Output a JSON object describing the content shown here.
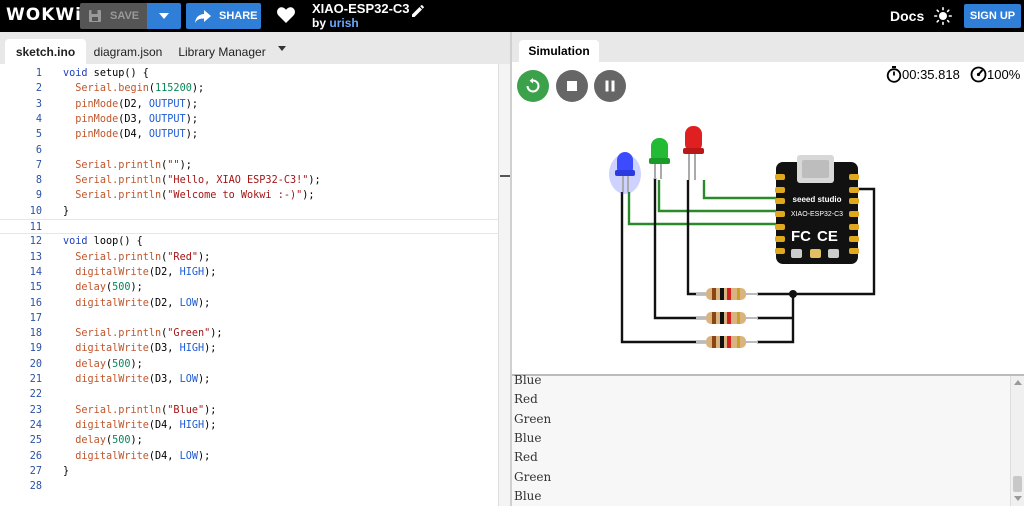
{
  "topbar": {
    "logo": "WOKWi",
    "save_label": "SAVE",
    "share_label": "SHARE",
    "project_title": "XIAO-ESP32-C3",
    "by_label": "by",
    "author": "urish",
    "docs_label": "Docs",
    "signup_label": "SIGN UP"
  },
  "editor": {
    "tabs": [
      "sketch.ino",
      "diagram.json",
      "Library Manager"
    ],
    "active_tab": "sketch.ino",
    "line_numbers": [
      "1",
      "2",
      "3",
      "4",
      "5",
      "6",
      "7",
      "8",
      "9",
      "10",
      "11",
      "12",
      "13",
      "14",
      "15",
      "16",
      "17",
      "18",
      "19",
      "20",
      "21",
      "22",
      "23",
      "24",
      "25",
      "26",
      "27",
      "28"
    ],
    "lines": [
      "void setup() {",
      "  Serial.begin(115200);",
      "  pinMode(D2, OUTPUT);",
      "  pinMode(D3, OUTPUT);",
      "  pinMode(D4, OUTPUT);",
      "",
      "  Serial.println(\"\");",
      "  Serial.println(\"Hello, XIAO ESP32-C3!\");",
      "  Serial.println(\"Welcome to Wokwi :-)\");",
      "}",
      "",
      "void loop() {",
      "  Serial.println(\"Red\");",
      "  digitalWrite(D2, HIGH);",
      "  delay(500);",
      "  digitalWrite(D2, LOW);",
      "",
      "  Serial.println(\"Green\");",
      "  digitalWrite(D3, HIGH);",
      "  delay(500);",
      "  digitalWrite(D3, LOW);",
      "",
      "  Serial.println(\"Blue\");",
      "  digitalWrite(D4, HIGH);",
      "  delay(500);",
      "  digitalWrite(D4, LOW);",
      "}",
      ""
    ],
    "current_line": "11"
  },
  "simulation": {
    "tab_label": "Simulation",
    "timer": "00:35.818",
    "speed": "100%",
    "board_brand": "seeed studio",
    "board_name": "XIAO-ESP32-C3",
    "board_fcc": "FC",
    "board_ce": "CE",
    "led_colors": {
      "blue": "#3d4bff",
      "green": "#22bb33",
      "red": "#e02020"
    },
    "accent": "#2f7ed8",
    "run_color": "#3ba14a"
  },
  "serial": {
    "lines": [
      "Blue",
      "Red",
      "Green",
      "Blue",
      "Red",
      "Green",
      "Blue"
    ]
  }
}
